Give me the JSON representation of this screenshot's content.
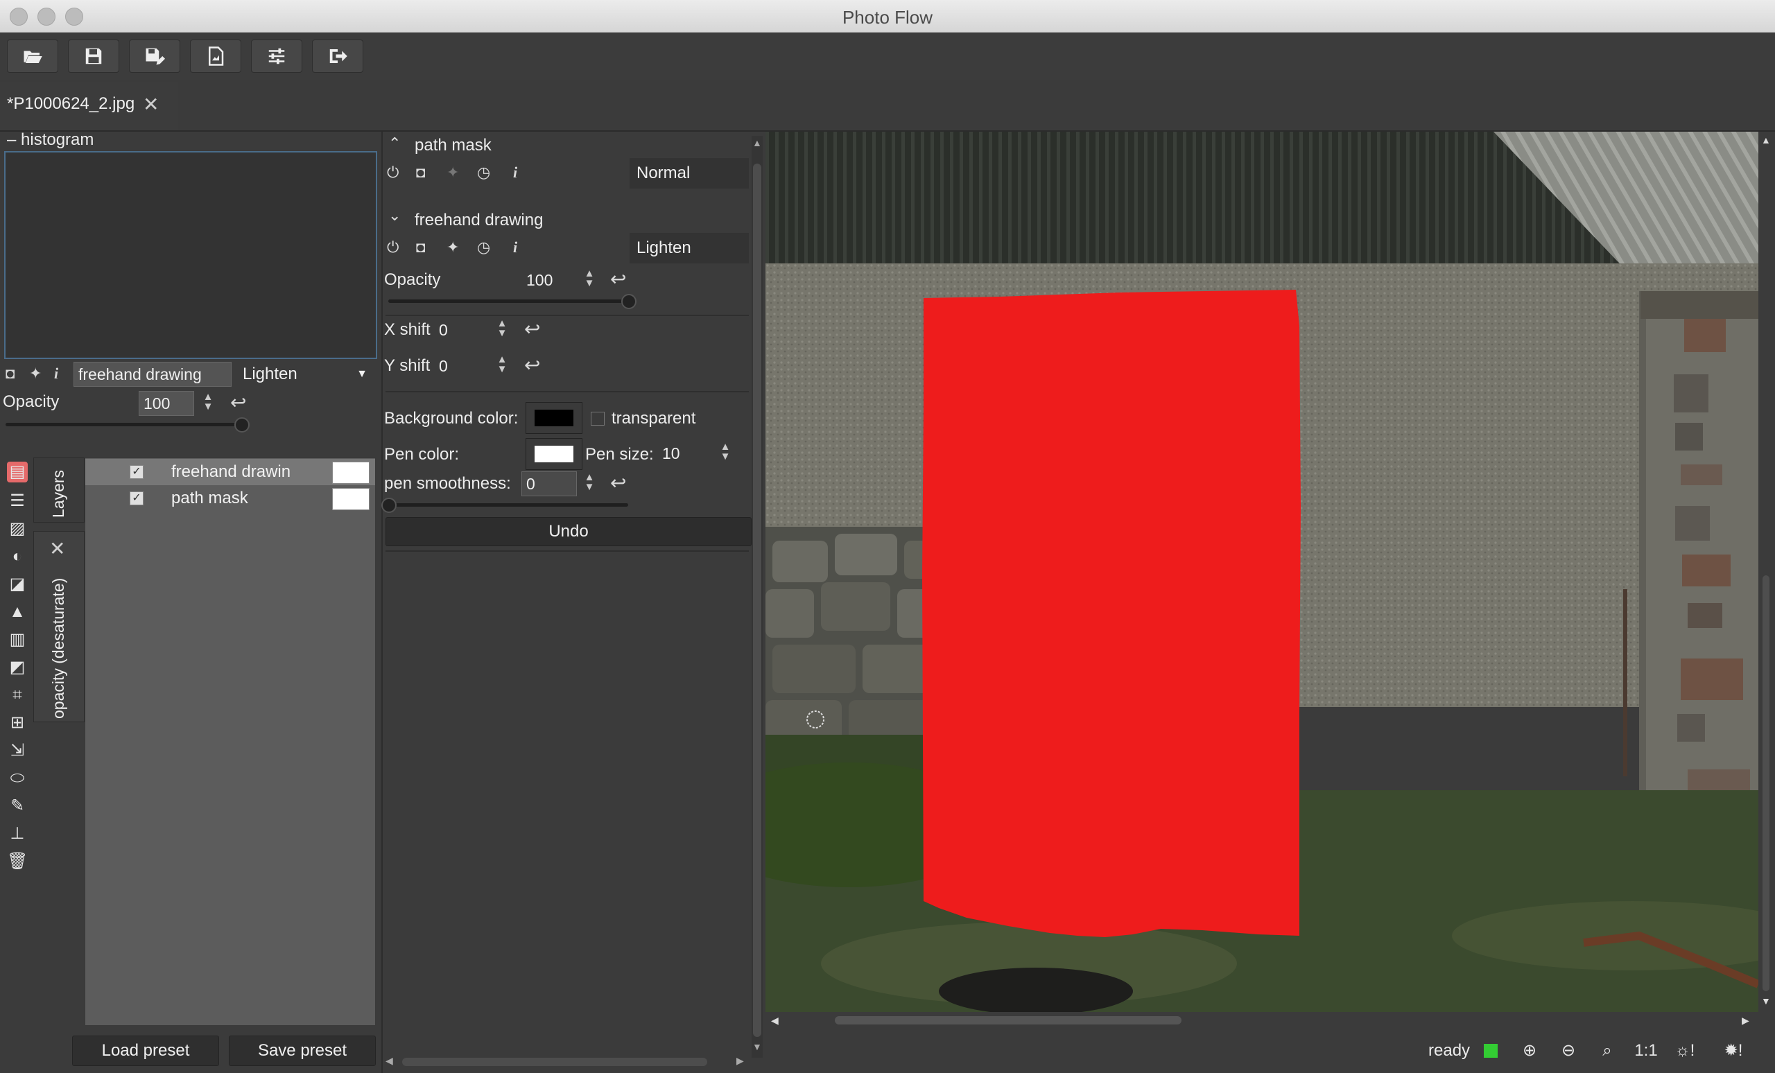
{
  "window": {
    "title": "Photo Flow"
  },
  "toolbar": {
    "buttons": [
      {
        "icon": "folder-open-icon"
      },
      {
        "icon": "save-icon"
      },
      {
        "icon": "save-as-icon"
      },
      {
        "icon": "export-icon"
      },
      {
        "icon": "settings-sliders-icon"
      },
      {
        "icon": "exit-icon"
      }
    ]
  },
  "tabs": [
    {
      "label": "*P1000624_2.jpg"
    }
  ],
  "histogram": {
    "header": "– histogram"
  },
  "layer_controls": {
    "name_value": "freehand drawing",
    "blend_mode": "Lighten",
    "opacity_label": "Opacity",
    "opacity_value": "100",
    "opacity_fraction": 1.0
  },
  "side_tabs": {
    "layers": "Layers",
    "opacity_tab": "opacity (desaturate)"
  },
  "layers": [
    {
      "name": "freehand drawin",
      "checked": true,
      "selected": true
    },
    {
      "name": "path mask",
      "checked": true,
      "selected": false
    }
  ],
  "presets": {
    "load_label": "Load preset",
    "save_label": "Save preset"
  },
  "path_mask": {
    "title": "path mask",
    "blend": "Normal"
  },
  "freehand": {
    "title": "freehand drawing",
    "blend": "Lighten",
    "opacity_label": "Opacity",
    "opacity_value": "100",
    "opacity_fraction": 1.0,
    "xshift_label": "X shift",
    "xshift_value": "0",
    "yshift_label": "Y shift",
    "yshift_value": "0",
    "bg_color_label": "Background color:",
    "bg_color": "#000000",
    "transparent_label": "transparent",
    "pen_color_label": "Pen color:",
    "pen_color": "#ffffff",
    "pen_size_label": "Pen size:",
    "pen_size_value": "10",
    "smooth_label": "pen smoothness:",
    "smooth_value": "0",
    "smooth_fraction": 0.0,
    "undo_label": "Undo"
  },
  "status": {
    "text": "ready",
    "indicator_color": "#33cc33",
    "zoom_1to1": "1:1"
  },
  "colors": {
    "paint_red": "#ee1c1c"
  }
}
